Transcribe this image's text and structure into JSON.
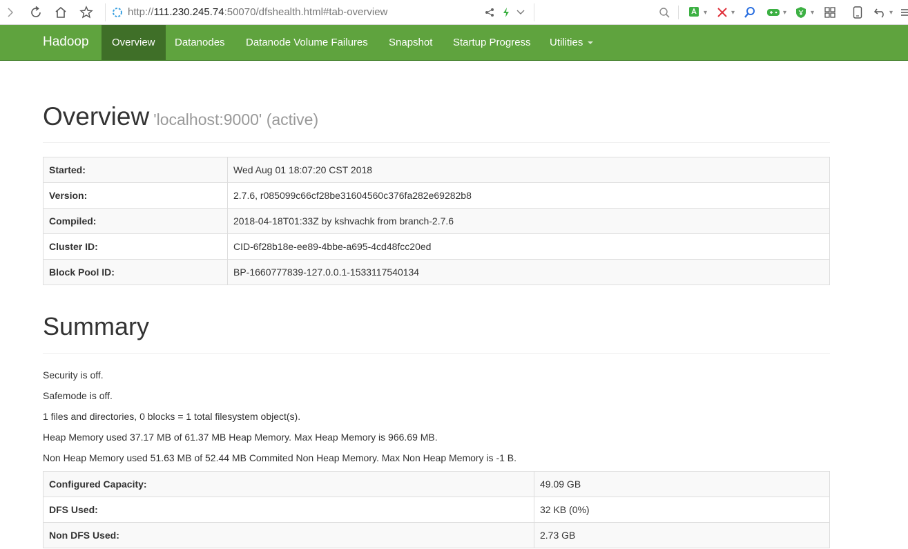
{
  "browser": {
    "url_prefix": "http://",
    "url_host": "111.230.245.74",
    "url_rest": ":50070/dfshealth.html#tab-overview"
  },
  "navbar": {
    "brand": "Hadoop",
    "items": [
      {
        "label": "Overview",
        "active": true
      },
      {
        "label": "Datanodes",
        "active": false
      },
      {
        "label": "Datanode Volume Failures",
        "active": false
      },
      {
        "label": "Snapshot",
        "active": false
      },
      {
        "label": "Startup Progress",
        "active": false
      },
      {
        "label": "Utilities",
        "active": false
      }
    ],
    "colors": {
      "bar": "#5fa33e",
      "active": "#3f6f28"
    }
  },
  "overview": {
    "title": "Overview",
    "subtitle": "'localhost:9000' (active)",
    "rows": [
      {
        "label": "Started:",
        "value": "Wed Aug 01 18:07:20 CST 2018"
      },
      {
        "label": "Version:",
        "value": "2.7.6, r085099c66cf28be31604560c376fa282e69282b8"
      },
      {
        "label": "Compiled:",
        "value": "2018-04-18T01:33Z by kshvachk from branch-2.7.6"
      },
      {
        "label": "Cluster ID:",
        "value": "CID-6f28b18e-ee89-4bbe-a695-4cd48fcc20ed"
      },
      {
        "label": "Block Pool ID:",
        "value": "BP-1660777839-127.0.0.1-1533117540134"
      }
    ]
  },
  "summary": {
    "title": "Summary",
    "lines": [
      "Security is off.",
      "Safemode is off.",
      "1 files and directories, 0 blocks = 1 total filesystem object(s).",
      "Heap Memory used 37.17 MB of 61.37 MB Heap Memory. Max Heap Memory is 966.69 MB.",
      "Non Heap Memory used 51.63 MB of 52.44 MB Commited Non Heap Memory. Max Non Heap Memory is -1 B."
    ],
    "rows": [
      {
        "label": "Configured Capacity:",
        "value": "49.09 GB"
      },
      {
        "label": "DFS Used:",
        "value": "32 KB (0%)"
      },
      {
        "label": "Non DFS Used:",
        "value": "2.73 GB"
      }
    ]
  }
}
